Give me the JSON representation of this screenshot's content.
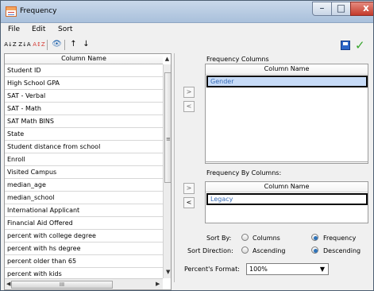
{
  "window": {
    "title": "Frequency",
    "controls": {
      "minimize": "–",
      "maximize": "□",
      "close": "x"
    }
  },
  "menu": [
    "File",
    "Edit",
    "Sort"
  ],
  "toolbar": {
    "sort_az": "A↓Z",
    "sort_za": "Z↓A",
    "sort_mixed": "A↕Z",
    "search": "👁",
    "up": "↑",
    "down": "↓"
  },
  "column_list": {
    "header": "Column Name",
    "items": [
      "Student ID",
      "High School GPA",
      "SAT - Verbal",
      "SAT - Math",
      "SAT Math BINS",
      "State",
      "Student distance from school",
      "Enroll",
      "Visited Campus",
      "median_age",
      "median_school",
      "International Applicant",
      "Financial Aid Offered",
      "percent with college degree",
      "percent with hs degree",
      "percent older than 65",
      "percent with kids"
    ],
    "scroll_thumb_label": "III"
  },
  "frequency_columns": {
    "label": "Frequency Columns",
    "header": "Column Name",
    "item": "Gender"
  },
  "frequency_by_columns": {
    "label": "Frequency By Columns:",
    "header": "Column Name",
    "item": "Legacy"
  },
  "move_buttons": {
    "add_frequency": ">",
    "remove_frequency": "<",
    "add_by": ">",
    "remove_by": "<"
  },
  "options": {
    "sort_by": {
      "label": "Sort By:",
      "columns": "Columns",
      "frequency": "Frequency",
      "selected": "frequency"
    },
    "sort_direction": {
      "label": "Sort Direction:",
      "ascending": "Ascending",
      "descending": "Descending",
      "selected": "descending"
    },
    "percent_format": {
      "label": "Percent's Format:",
      "value": "100%"
    }
  },
  "icons": {
    "app": "frequency-icon",
    "save": "save-icon",
    "ok": "check-icon"
  },
  "colors": {
    "selection_blue": "#c7dbf7",
    "text_blue": "#356ab5",
    "title_blue": "#a9c0db"
  }
}
